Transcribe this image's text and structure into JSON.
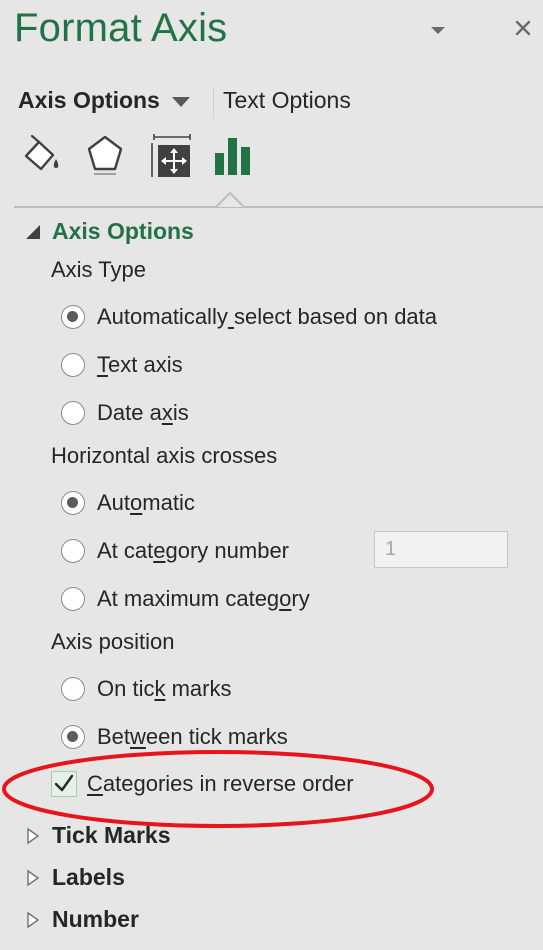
{
  "panel": {
    "title": "Format Axis",
    "dropdown_icon": "chevron-down-icon",
    "close_icon": "close-icon"
  },
  "tabs": {
    "axis_options": "Axis Options",
    "text_options": "Text Options"
  },
  "icon_tabs": [
    "fill-line-icon",
    "effects-icon",
    "size-properties-icon",
    "axis-options-icon"
  ],
  "sections": {
    "axis_options": "Axis Options",
    "tick_marks": "Tick Marks",
    "labels": "Labels",
    "number": "Number"
  },
  "axis_type": {
    "label": "Axis Type",
    "options": [
      {
        "pre": "Automatically",
        "u": " ",
        "post": "select based on data",
        "checked": true
      },
      {
        "pre": "",
        "u": "T",
        "post": "ext axis",
        "checked": false
      },
      {
        "pre": "Date a",
        "u": "x",
        "post": "is",
        "checked": false
      }
    ]
  },
  "horizontal_crosses": {
    "label": "Horizontal axis crosses",
    "options": [
      {
        "pre": "Aut",
        "u": "o",
        "post": "matic",
        "checked": true
      },
      {
        "pre": "At cat",
        "u": "e",
        "post": "gory number",
        "checked": false
      },
      {
        "pre": "At maximum categ",
        "u": "o",
        "post": "ry",
        "checked": false
      }
    ],
    "category_number_value": "1"
  },
  "axis_position": {
    "label": "Axis position",
    "options": [
      {
        "pre": "On tic",
        "u": "k",
        "post": " marks",
        "checked": false
      },
      {
        "pre": "Bet",
        "u": "w",
        "post": "een tick marks",
        "checked": true
      }
    ]
  },
  "reverse_order": {
    "pre": "",
    "u": "C",
    "post": "ategories in reverse order",
    "checked": true
  },
  "colors": {
    "accent": "#217346",
    "highlight": "#e8141c"
  }
}
